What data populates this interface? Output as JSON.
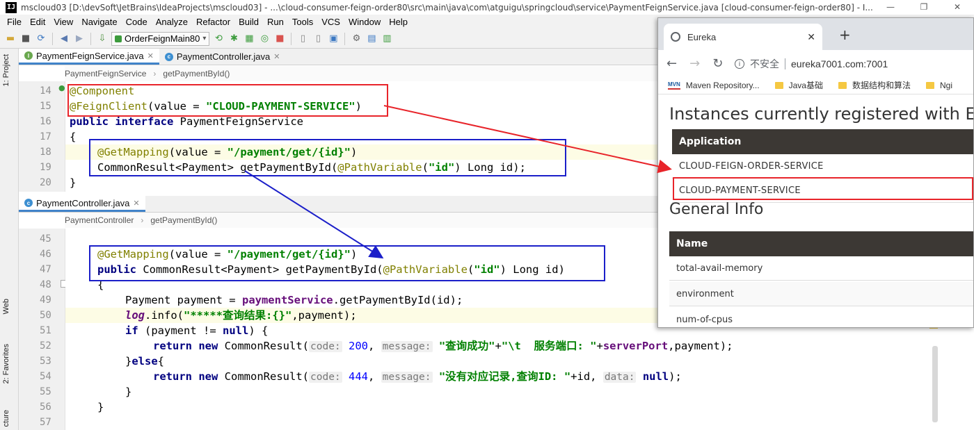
{
  "window": {
    "title": "mscloud03 [D:\\devSoft\\JetBrains\\IdeaProjects\\mscloud03] - ...\\cloud-consumer-feign-order80\\src\\main\\java\\com\\atguigu\\springcloud\\service\\PaymentFeignService.java [cloud-consumer-feign-order80] - I...",
    "logo": "IJ",
    "controls": [
      "—",
      "❐",
      "✕"
    ]
  },
  "menu": [
    "File",
    "Edit",
    "View",
    "Navigate",
    "Code",
    "Analyze",
    "Refactor",
    "Build",
    "Run",
    "Tools",
    "VCS",
    "Window",
    "Help"
  ],
  "toolbar": {
    "run_config": "OrderFeignMain80"
  },
  "side_tabs": {
    "project": "1: Project",
    "web": "Web",
    "favorites": "2: Favorites",
    "structure": "cture"
  },
  "top_editor": {
    "tabs": [
      {
        "label": "PaymentFeignService.java",
        "kind": "interface",
        "active": true
      },
      {
        "label": "PaymentController.java",
        "kind": "class",
        "active": false
      }
    ],
    "breadcrumb": [
      "PaymentFeignService",
      "getPaymentById()"
    ],
    "line_numbers": [
      "14",
      "15",
      "16",
      "17",
      "18",
      "19",
      "20"
    ]
  },
  "bottom_editor": {
    "tabs": [
      {
        "label": "PaymentController.java",
        "kind": "class",
        "active": true
      }
    ],
    "breadcrumb": [
      "PaymentController",
      "getPaymentById()"
    ],
    "line_numbers": [
      "45",
      "46",
      "47",
      "48",
      "49",
      "50",
      "51",
      "52",
      "53",
      "54",
      "55",
      "56",
      "57"
    ]
  },
  "code": {
    "l14": "@Component",
    "l15_ann": "@FeignClient",
    "l15_a": "(value = ",
    "l15_str": "\"CLOUD-PAYMENT-SERVICE\"",
    "l15_b": ")",
    "l16_kw1": "public",
    "l16_kw2": "interface",
    "l16_rest": " PaymentFeignService",
    "l17": "{",
    "l18_ann": "@GetMapping",
    "l18_a": "(value = ",
    "l18_str": "\"/payment/get/{id}\"",
    "l18_b": ")",
    "l19_a": "CommonResult<Payment> getPaymentById(",
    "l19_ann": "@PathVariable",
    "l19_b": "(",
    "l19_str": "\"id\"",
    "l19_c": ") Long id);",
    "l20": "}",
    "l46_ann": "@GetMapping",
    "l46_a": "(value = ",
    "l46_str": "\"/payment/get/{id}\"",
    "l46_b": ")",
    "l47_kw": "public",
    "l47_a": " CommonResult<Payment> getPaymentById(",
    "l47_ann": "@PathVariable",
    "l47_b": "(",
    "l47_str": "\"id\"",
    "l47_c": ") Long id)",
    "l48": "{",
    "l49_a": "Payment payment = ",
    "l49_field": "paymentService",
    "l49_b": ".getPaymentById(id);",
    "l50_static": "log",
    "l50_a": ".info(",
    "l50_str": "\"*****查询结果:{}\"",
    "l50_b": ",payment);",
    "l51_kw": "if",
    "l51_a": " (payment != ",
    "l51_kw2": "null",
    "l51_b": ") {",
    "l52_kw": "return",
    "l52_kw2": "new",
    "l52_a": " CommonResult(",
    "l52_hint1": "code:",
    "l52_num": " 200",
    "l52_c": ", ",
    "l52_hint2": "message:",
    "l52_str1": " \"查询成功\"",
    "l52_plus": "+",
    "l52_str2": "\"\\t  服务端口: \"",
    "l52_plus2": "+",
    "l52_field": "serverPort",
    "l52_end": ",payment);",
    "l53_a": "}",
    "l53_kw": "else",
    "l53_b": "{",
    "l54_kw": "return",
    "l54_kw2": "new",
    "l54_a": " CommonResult(",
    "l54_hint1": "code:",
    "l54_num": " 444",
    "l54_c": ", ",
    "l54_hint2": "message:",
    "l54_str": " \"没有对应记录,查询ID: \"",
    "l54_d": "+id, ",
    "l54_hint3": "data:",
    "l54_kw3": " null",
    "l54_end": ");",
    "l55": "}",
    "l56": "}"
  },
  "browser": {
    "tab_title": "Eureka",
    "tab_close": "✕",
    "new_tab": "+",
    "nav": {
      "back": "←",
      "forward": "→",
      "reload": "↻"
    },
    "omnibox": {
      "security_label": "不安全",
      "url": "eureka7001.com:7001"
    },
    "bookmarks": [
      "Maven Repository...",
      "Java基础",
      "数据结构和算法",
      "Ngi"
    ],
    "mvn_badge": "MVN",
    "heading": "Instances currently registered with Eureka",
    "registered_table": {
      "header": "Application",
      "rows": [
        "CLOUD-FEIGN-ORDER-SERVICE",
        "CLOUD-PAYMENT-SERVICE"
      ]
    },
    "general_info": {
      "heading": "General Info",
      "header": "Name",
      "rows": [
        "total-avail-memory",
        "environment",
        "num-of-cpus"
      ]
    }
  },
  "colors": {
    "annotation_box": "#e8242a",
    "mapping_box": "#1b1fc9"
  }
}
